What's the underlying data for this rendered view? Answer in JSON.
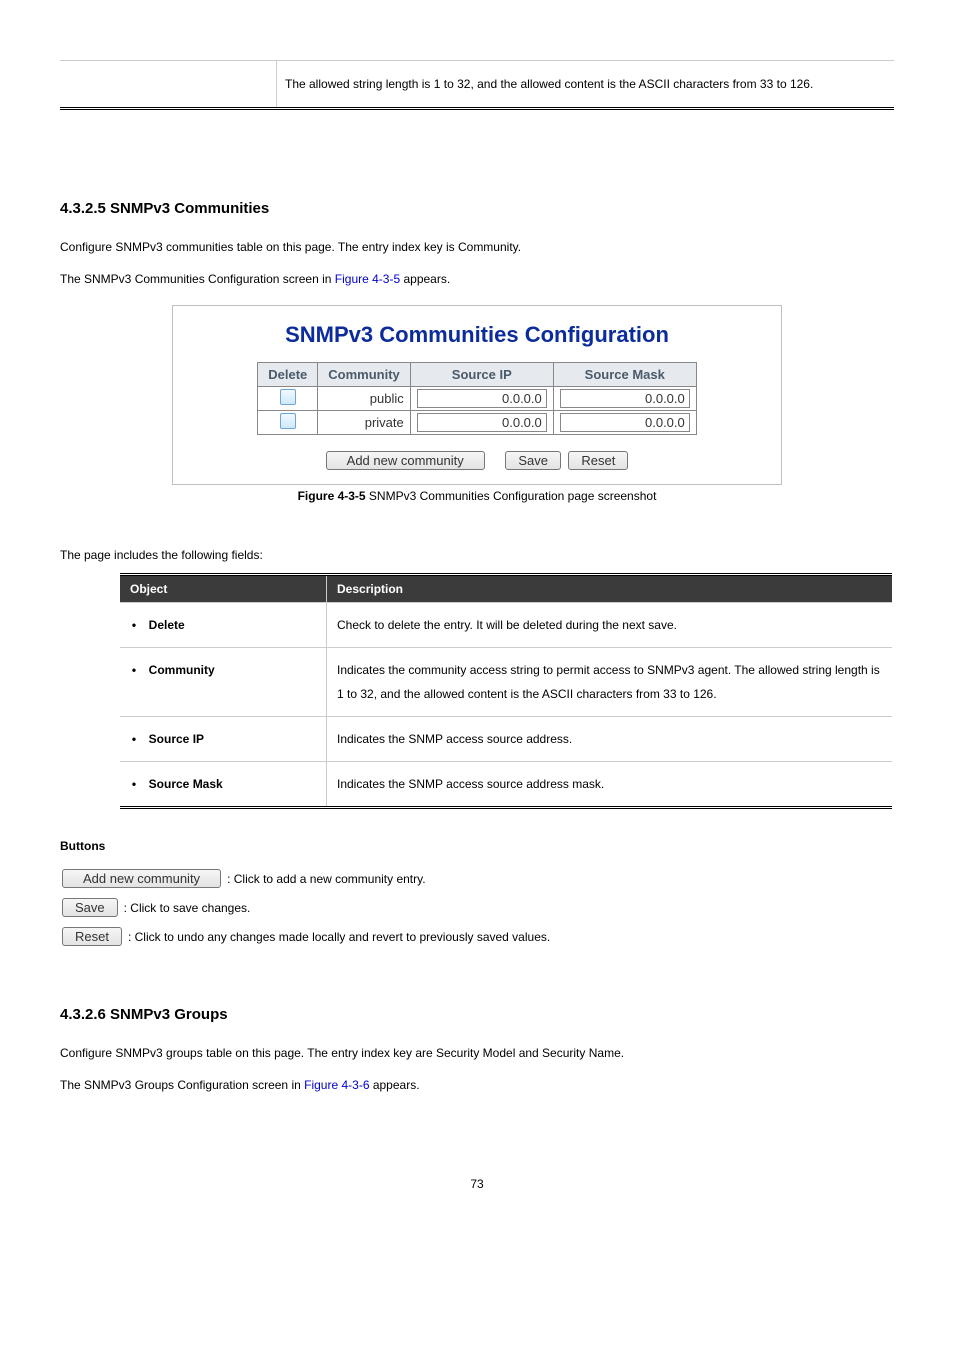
{
  "top_table": {
    "text": "The allowed string length is 1 to 32, and the allowed content is the ASCII characters from 33 to 126."
  },
  "section1": {
    "number": "4.3.2.5",
    "title": "SNMPv3 Communities",
    "para1": "Configure SNMPv3 communities table on this page. The entry index key is Community.",
    "para2_pre": "The SNMPv3 Communities Configuration screen in ",
    "para2_link": "Figure 4-3-5",
    "para2_post": " appears."
  },
  "screenshot": {
    "title": "SNMPv3 Communities Configuration",
    "headers": {
      "c1": "Delete",
      "c2": "Community",
      "c3": "Source IP",
      "c4": "Source Mask"
    },
    "rows": [
      {
        "community": "public",
        "source_ip": "0.0.0.0",
        "source_mask": "0.0.0.0"
      },
      {
        "community": "private",
        "source_ip": "0.0.0.0",
        "source_mask": "0.0.0.0"
      }
    ],
    "btn_add": "Add new community",
    "btn_save": "Save",
    "btn_reset": "Reset"
  },
  "caption": {
    "figno": "Figure 4-3-5",
    "text": " SNMPv3 Communities Configuration page screenshot"
  },
  "fields_intro": "The page includes the following fields:",
  "fields_table": {
    "h1": "Object",
    "h2": "Description",
    "rows": [
      {
        "obj": "Delete",
        "desc": "Check to delete the entry. It will be deleted during the next save."
      },
      {
        "obj": "Community",
        "desc": "Indicates the community access string to permit access to SNMPv3 agent. The allowed string length is 1 to 32, and the allowed content is the ASCII characters from 33 to 126."
      },
      {
        "obj": "Source IP",
        "desc": "Indicates the SNMP access source address."
      },
      {
        "obj": "Source Mask",
        "desc": "Indicates the SNMP access source address mask."
      }
    ]
  },
  "buttons_heading": "Buttons",
  "buttons": {
    "add": {
      "label": "Add new community",
      "desc": ": Click to add a new community entry."
    },
    "save": {
      "label": "Save",
      "desc": ": Click to save changes."
    },
    "reset": {
      "label": "Reset",
      "desc": ": Click to undo any changes made locally and revert to previously saved values."
    }
  },
  "section2": {
    "number": "4.3.2.6",
    "title": "SNMPv3 Groups",
    "para1": "Configure SNMPv3 groups table on this page. The entry index key are Security Model and Security Name.",
    "para2_pre": "The SNMPv3 Groups Configuration screen in ",
    "para2_link": "Figure 4-3-6",
    "para2_post": " appears."
  },
  "page_number": "73"
}
